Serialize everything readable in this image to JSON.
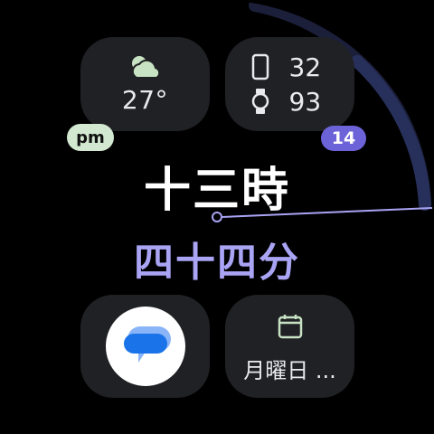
{
  "weather": {
    "icon": "partly-cloudy-icon",
    "temperature": "27°"
  },
  "battery": {
    "phone_icon": "phone-icon",
    "phone_level": "32",
    "watch_icon": "watch-icon",
    "watch_level": "93"
  },
  "badges": {
    "ampm": "pm",
    "notification_count": "14"
  },
  "time": {
    "hours": "十三時",
    "minutes": "四十四分"
  },
  "messages": {
    "icon": "messages-app-icon"
  },
  "calendar": {
    "icon": "calendar-icon",
    "text": "月曜日 ..."
  },
  "colors": {
    "background": "#000000",
    "tile": "#202124",
    "hours_text": "#ffffff",
    "minutes_text": "#a9a4f4",
    "accent": "#6c63d8",
    "pm_badge": "#d2e8d0",
    "arc": "#1c1f3a"
  }
}
